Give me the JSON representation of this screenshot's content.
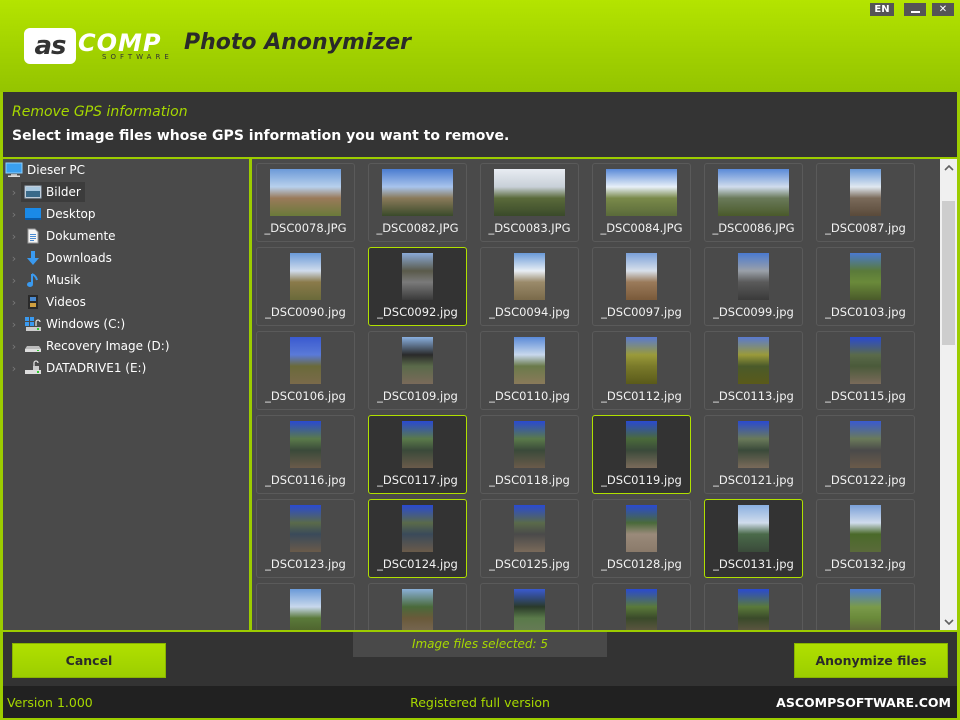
{
  "window": {
    "app_title": "Photo Anonymizer",
    "logo": {
      "as": "as",
      "comp": "COMP",
      "software": "SOFTWARE"
    },
    "language_button": "EN",
    "minimize_icon": "minimize-icon",
    "close_icon": "close-icon",
    "close_glyph": "✕"
  },
  "instructions": {
    "subtitle": "Remove GPS information",
    "title": "Select image files whose GPS information you want to remove."
  },
  "tree": {
    "root": {
      "label": "Dieser PC",
      "icon": "computer-icon"
    },
    "items": [
      {
        "label": "Bilder",
        "icon": "pictures-folder-icon",
        "selected": true
      },
      {
        "label": "Desktop",
        "icon": "desktop-folder-icon",
        "selected": false
      },
      {
        "label": "Dokumente",
        "icon": "documents-folder-icon",
        "selected": false
      },
      {
        "label": "Downloads",
        "icon": "download-arrow-icon",
        "selected": false
      },
      {
        "label": "Musik",
        "icon": "music-note-icon",
        "selected": false
      },
      {
        "label": "Videos",
        "icon": "film-icon",
        "selected": false
      },
      {
        "label": "Windows  (C:)",
        "icon": "windows-drive-icon",
        "selected": false
      },
      {
        "label": "Recovery Image (D:)",
        "icon": "drive-icon",
        "selected": false
      },
      {
        "label": "DATADRIVE1 (E:)",
        "icon": "network-drive-icon",
        "selected": false
      }
    ],
    "chevron_glyph": "›"
  },
  "images": [
    {
      "name": "_DSC0078.JPG",
      "selected": false,
      "orientation": "landscape",
      "palette": [
        "#6c9ad8",
        "#b8d0ec",
        "#9a7a5a",
        "#6a7a3a"
      ]
    },
    {
      "name": "_DSC0082.JPG",
      "selected": false,
      "orientation": "landscape",
      "palette": [
        "#4a7cd0",
        "#a8c4ec",
        "#8a7a5a",
        "#3a4a2a"
      ]
    },
    {
      "name": "_DSC0083.JPG",
      "selected": false,
      "orientation": "landscape",
      "palette": [
        "#e8ecf2",
        "#c8d0d8",
        "#5a6a3a",
        "#3a4a2a"
      ]
    },
    {
      "name": "_DSC0084.JPG",
      "selected": false,
      "orientation": "landscape",
      "palette": [
        "#5a8ad8",
        "#e8f0f8",
        "#7a8a4a",
        "#5a6a3a"
      ]
    },
    {
      "name": "_DSC0086.JPG",
      "selected": false,
      "orientation": "landscape",
      "palette": [
        "#5a8ad8",
        "#d0dcec",
        "#6a7a5a",
        "#4a5a2a"
      ]
    },
    {
      "name": "_DSC0087.jpg",
      "selected": false,
      "orientation": "portrait",
      "palette": [
        "#6a9ad8",
        "#e0e8f0",
        "#7a6a5a",
        "#5a4a3a"
      ]
    },
    {
      "name": "_DSC0090.jpg",
      "selected": false,
      "orientation": "portrait",
      "palette": [
        "#6a9ad8",
        "#d0dcec",
        "#8a7a4a",
        "#6a6a3a"
      ]
    },
    {
      "name": "_DSC0092.jpg",
      "selected": true,
      "orientation": "portrait",
      "palette": [
        "#8aaad8",
        "#5a5a4a",
        "#7a7a7a",
        "#3a3a3a"
      ]
    },
    {
      "name": "_DSC0094.jpg",
      "selected": false,
      "orientation": "portrait",
      "palette": [
        "#6a9ad8",
        "#e8eef4",
        "#9a8a6a",
        "#7a6a4a"
      ]
    },
    {
      "name": "_DSC0097.jpg",
      "selected": false,
      "orientation": "portrait",
      "palette": [
        "#7aa0d8",
        "#d8e0ea",
        "#9a7a5a",
        "#7a5a3a"
      ]
    },
    {
      "name": "_DSC0099.jpg",
      "selected": false,
      "orientation": "portrait",
      "palette": [
        "#4a7ad0",
        "#9aa0a8",
        "#5a5a5a",
        "#3a3a3a"
      ]
    },
    {
      "name": "_DSC0103.jpg",
      "selected": false,
      "orientation": "portrait",
      "palette": [
        "#4a7ad0",
        "#5a7a3a",
        "#6a8a3a",
        "#4a5a2a"
      ]
    },
    {
      "name": "_DSC0106.jpg",
      "selected": false,
      "orientation": "portrait",
      "palette": [
        "#3a5ad0",
        "#5a7ad8",
        "#6a6a3a",
        "#7a6a4a"
      ]
    },
    {
      "name": "_DSC0109.jpg",
      "selected": false,
      "orientation": "portrait",
      "palette": [
        "#8ab0e0",
        "#2a2a2a",
        "#5a6a4a",
        "#7a6a5a"
      ]
    },
    {
      "name": "_DSC0110.jpg",
      "selected": false,
      "orientation": "portrait",
      "palette": [
        "#5a8ad8",
        "#c8d8ec",
        "#6a7a4a",
        "#8a7a5a"
      ]
    },
    {
      "name": "_DSC0112.jpg",
      "selected": false,
      "orientation": "portrait",
      "palette": [
        "#5a7ad0",
        "#9a9a3a",
        "#7a7a2a",
        "#5a5a1a"
      ]
    },
    {
      "name": "_DSC0113.jpg",
      "selected": false,
      "orientation": "portrait",
      "palette": [
        "#5a7ad0",
        "#9a9a3a",
        "#4a5a2a",
        "#5a5a1a"
      ]
    },
    {
      "name": "_DSC0115.jpg",
      "selected": false,
      "orientation": "portrait",
      "palette": [
        "#2a4ad0",
        "#5a6a4a",
        "#4a5a3a",
        "#7a6a5a"
      ]
    },
    {
      "name": "_DSC0116.jpg",
      "selected": false,
      "orientation": "portrait",
      "palette": [
        "#2a4ad0",
        "#5a7a4a",
        "#3a4a3a",
        "#6a5a4a"
      ]
    },
    {
      "name": "_DSC0117.jpg",
      "selected": true,
      "orientation": "portrait",
      "palette": [
        "#2a4ad0",
        "#5a7a4a",
        "#3a4a3a",
        "#6a5a4a"
      ]
    },
    {
      "name": "_DSC0118.jpg",
      "selected": false,
      "orientation": "portrait",
      "palette": [
        "#2a4ad0",
        "#5a7a4a",
        "#3a4a3a",
        "#6a5a4a"
      ]
    },
    {
      "name": "_DSC0119.jpg",
      "selected": true,
      "orientation": "portrait",
      "palette": [
        "#2a4ad0",
        "#4a6a3a",
        "#3a4a3a",
        "#7a6a5a"
      ]
    },
    {
      "name": "_DSC0121.jpg",
      "selected": false,
      "orientation": "portrait",
      "palette": [
        "#2a4ad0",
        "#6a7a5a",
        "#3a4a3a",
        "#7a6a5a"
      ]
    },
    {
      "name": "_DSC0122.jpg",
      "selected": false,
      "orientation": "portrait",
      "palette": [
        "#3a5ad0",
        "#6a7a5a",
        "#4a4a4a",
        "#6a5a4a"
      ]
    },
    {
      "name": "_DSC0123.jpg",
      "selected": false,
      "orientation": "portrait",
      "palette": [
        "#2a4ad0",
        "#5a6a4a",
        "#3a4a5a",
        "#6a5a4a"
      ]
    },
    {
      "name": "_DSC0124.jpg",
      "selected": true,
      "orientation": "portrait",
      "palette": [
        "#2a4ad0",
        "#5a6a4a",
        "#3a4a5a",
        "#6a5a4a"
      ]
    },
    {
      "name": "_DSC0125.jpg",
      "selected": false,
      "orientation": "portrait",
      "palette": [
        "#2a4ad0",
        "#5a6a4a",
        "#4a4a4a",
        "#7a6a5a"
      ]
    },
    {
      "name": "_DSC0128.jpg",
      "selected": false,
      "orientation": "portrait",
      "palette": [
        "#2a4ad0",
        "#4a6a3a",
        "#9a8a7a",
        "#8a7a6a"
      ]
    },
    {
      "name": "_DSC0131.jpg",
      "selected": true,
      "orientation": "portrait",
      "palette": [
        "#8ab0e0",
        "#d0dcec",
        "#4a6a4a",
        "#3a4a3a"
      ]
    },
    {
      "name": "_DSC0132.jpg",
      "selected": false,
      "orientation": "portrait",
      "palette": [
        "#7aa0d8",
        "#d0dcec",
        "#4a6a2a",
        "#5a6a3a"
      ]
    },
    {
      "name": "",
      "selected": false,
      "orientation": "portrait",
      "palette": [
        "#6a9ad8",
        "#c8d8ec",
        "#5a7a3a",
        "#4a5a2a"
      ]
    },
    {
      "name": "",
      "selected": false,
      "orientation": "portrait",
      "palette": [
        "#8ab0d8",
        "#4a6a3a",
        "#6a5a3a",
        "#7a6a5a"
      ]
    },
    {
      "name": "",
      "selected": false,
      "orientation": "portrait",
      "palette": [
        "#3a5ad0",
        "#2a3a2a",
        "#5a7a4a",
        "#6a7a5a"
      ]
    },
    {
      "name": "",
      "selected": false,
      "orientation": "portrait",
      "palette": [
        "#2a4ad0",
        "#5a7a3a",
        "#3a4a2a",
        "#6a5a4a"
      ]
    },
    {
      "name": "",
      "selected": false,
      "orientation": "portrait",
      "palette": [
        "#2a4ad0",
        "#5a7a3a",
        "#3a4a2a",
        "#6a5a4a"
      ]
    },
    {
      "name": "",
      "selected": false,
      "orientation": "portrait",
      "palette": [
        "#4a7ad0",
        "#7a9a4a",
        "#6a8a3a",
        "#5a5a3a"
      ]
    }
  ],
  "status": {
    "selected_text": "Image files selected: 5"
  },
  "buttons": {
    "cancel": "Cancel",
    "anonymize": "Anonymize files"
  },
  "footer": {
    "version": "Version 1.000",
    "registration": "Registered full version",
    "website": "ASCOMPSOFTWARE.COM"
  },
  "scrollbar": {
    "up_glyph": "⌃",
    "down_glyph": "⌄",
    "position_fraction": 0.0
  },
  "colors": {
    "accent": "#9ccc00",
    "accent_text": "#a6d800",
    "dark_bg": "#333333",
    "panel_bg": "#4a4a4a",
    "footer_bg": "#212121"
  }
}
